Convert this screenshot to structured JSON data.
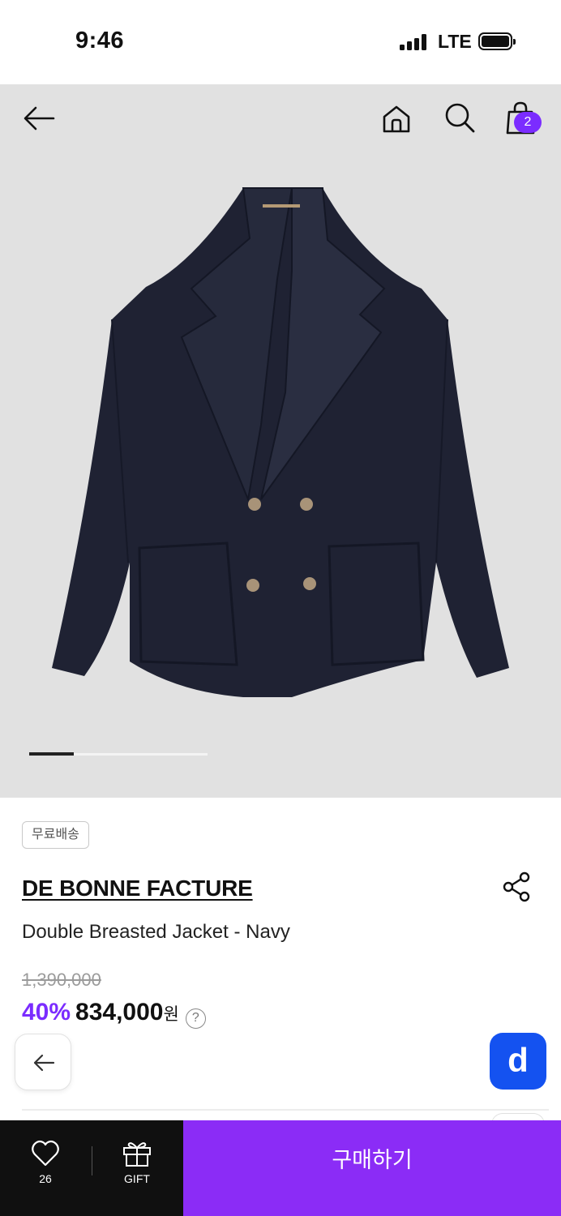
{
  "status": {
    "time": "9:46",
    "network": "LTE"
  },
  "header": {
    "cart_count": "2"
  },
  "gallery": {
    "image_alt": "Navy double breasted jacket",
    "current_index": 1
  },
  "product": {
    "tag": "무료배송",
    "brand": "DE BONNE FACTURE",
    "name": "Double Breasted Jacket - Navy",
    "original_price": "1,390,000",
    "discount": "40%",
    "price": "834,000",
    "currency": "원",
    "help_symbol": "?"
  },
  "floating": {
    "d_label": "d"
  },
  "bottom_bar": {
    "like_count": "26",
    "gift_label": "GIFT",
    "buy_label": "구매하기"
  },
  "colors": {
    "accent": "#8b2cf6",
    "badge": "#7b2cff",
    "d_button": "#1452f0"
  }
}
